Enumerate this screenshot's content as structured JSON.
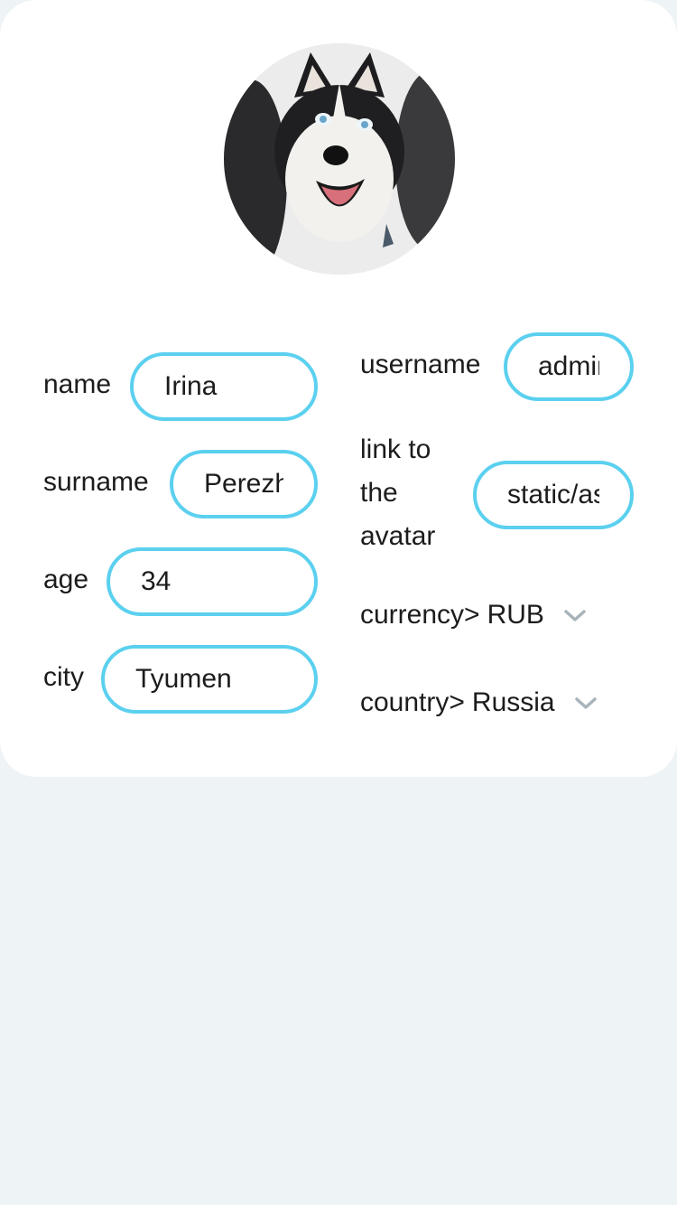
{
  "profile": {
    "avatar_icon": "husky-dog-avatar",
    "fields": {
      "name": {
        "label": "name",
        "value": "Irina"
      },
      "surname": {
        "label": "surname",
        "value": "Perezhogina"
      },
      "age": {
        "label": "age",
        "value": "34"
      },
      "city": {
        "label": "city",
        "value": "Tyumen"
      },
      "username": {
        "label": "username",
        "value": "admin"
      },
      "avatar_link": {
        "label_line1": "link to",
        "label_line2": "the",
        "label_line3": "avatar",
        "value": "static/assets/avatar.jpg"
      }
    },
    "currency": {
      "label": "currency>",
      "value": "RUB"
    },
    "country": {
      "label": "country>",
      "value": "Russia"
    }
  },
  "colors": {
    "input_border": "#5bd0ef",
    "page_background": "#eef3f6",
    "card_background": "#ffffff",
    "chevron": "#a9b4ba"
  }
}
